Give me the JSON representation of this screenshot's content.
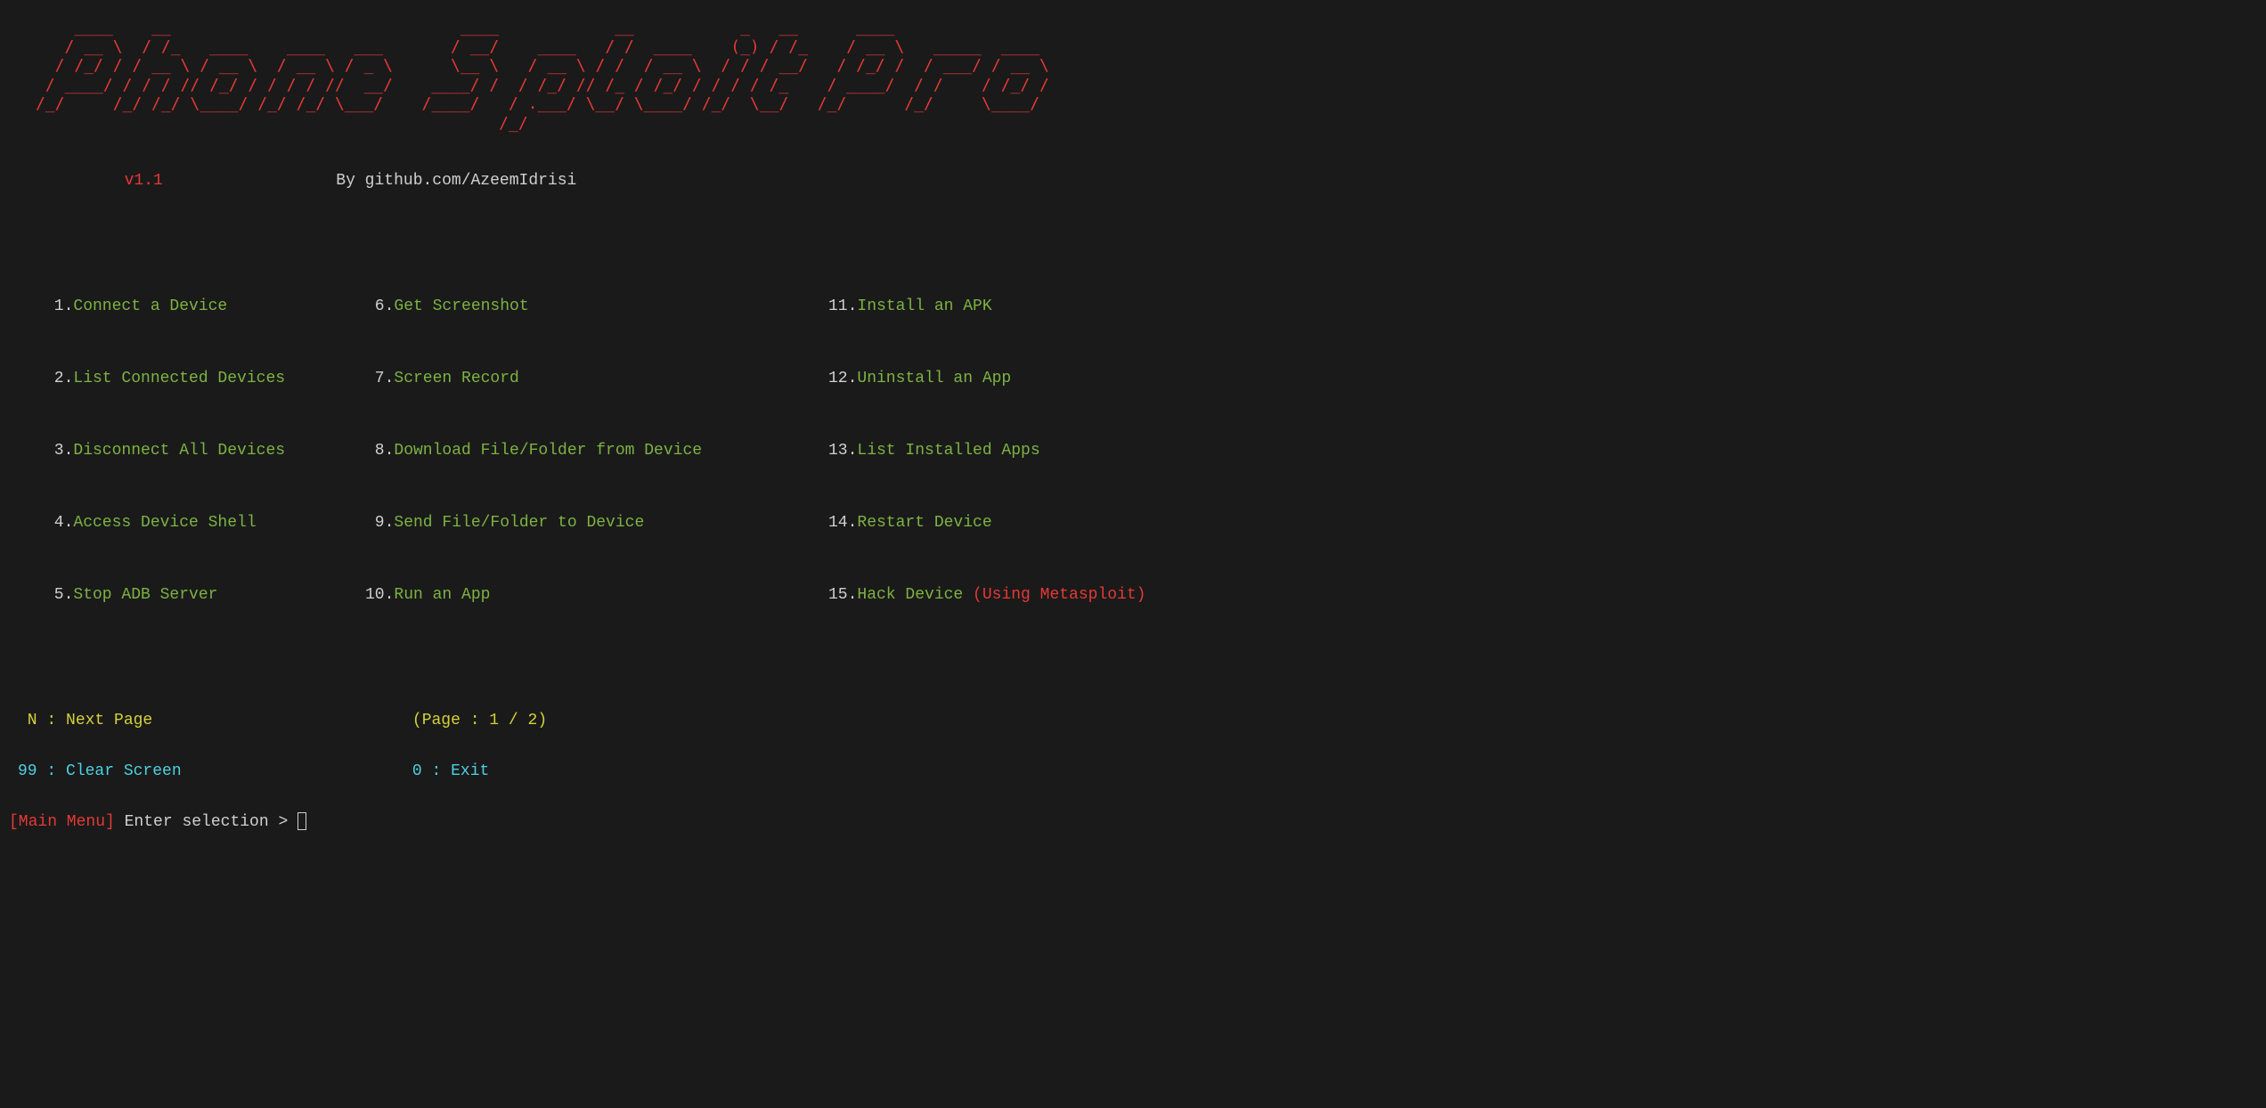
{
  "ascii_banner": "    ____    __                              ____            __           _   __      ____                 \n   / __ \\  / /_   ____    ____   ___       / __/    ____   / /  ____    (_) / /_    / __ \\   _____  ____  \n  / /_/ / / __ \\ / __ \\  / __ \\ / _ \\      \\__ \\   / __ \\ / /  / __ \\  / / / __/   / /_/ /  / ___/ / __ \\ \n / ____/ / / / // /_/ / / / / //  __/    ____/ /  / /_/ // /_ / /_/ / / / / /_    / ____/  / /    / /_/ / \n/_/     /_/ /_/ \\____/ /_/ /_/ \\___/    /____/   / .___/ \\__/ \\____/ /_/  \\__/   /_/      /_/     \\____/  \n                                                /_/                                                        ",
  "version": "v1.1",
  "author": "By github.com/AzeemIdrisi",
  "menu": {
    "col1": [
      {
        "num": " 1.",
        "label": "Connect a Device"
      },
      {
        "num": " 2.",
        "label": "List Connected Devices"
      },
      {
        "num": " 3.",
        "label": "Disconnect All Devices"
      },
      {
        "num": " 4.",
        "label": "Access Device Shell"
      },
      {
        "num": " 5.",
        "label": "Stop ADB Server"
      }
    ],
    "col2": [
      {
        "num": " 6.",
        "label": "Get Screenshot"
      },
      {
        "num": " 7.",
        "label": "Screen Record"
      },
      {
        "num": " 8.",
        "label": "Download File/Folder from Device"
      },
      {
        "num": " 9.",
        "label": "Send File/Folder to Device"
      },
      {
        "num": "10.",
        "label": "Run an App"
      }
    ],
    "col3": [
      {
        "num": "11.",
        "label": "Install an APK",
        "extra": ""
      },
      {
        "num": "12.",
        "label": "Uninstall an App",
        "extra": ""
      },
      {
        "num": "13.",
        "label": "List Installed Apps",
        "extra": ""
      },
      {
        "num": "14.",
        "label": "Restart Device",
        "extra": ""
      },
      {
        "num": "15.",
        "label": "Hack Device ",
        "extra": "(Using Metasploit)"
      }
    ]
  },
  "nav": {
    "next_key": " N : ",
    "next_label": "Next Page",
    "page_info": "(Page : 1 / 2)",
    "clear_key": "99 : ",
    "clear_label": "Clear Screen",
    "exit_key": " 0 : ",
    "exit_label": "Exit"
  },
  "prompt": {
    "context": "[Main Menu]",
    "text": " Enter selection > "
  }
}
